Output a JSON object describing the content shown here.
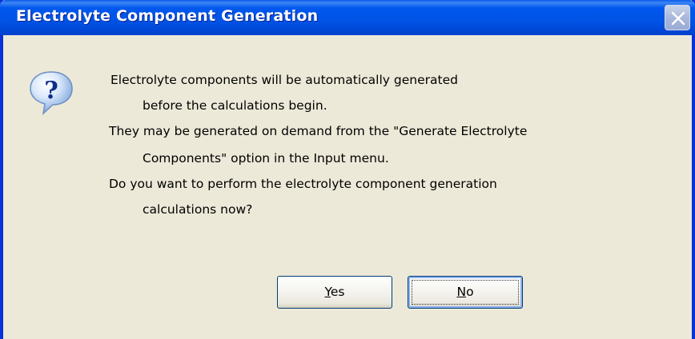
{
  "window": {
    "title": "Electrolyte Component Generation"
  },
  "icons": {
    "close": "close-icon",
    "message": "question-icon"
  },
  "message": {
    "lines": [
      "Electrolyte components will be automatically generated",
      "before the calculations begin.",
      "They may be generated on demand from the \"Generate Electrolyte",
      "Components\" option in the Input menu.",
      "Do you want to perform the electrolyte component generation",
      "calculations now?"
    ]
  },
  "buttons": {
    "yes_mnemonic": "Y",
    "yes_rest": "es",
    "no_mnemonic": "N",
    "no_rest": "o"
  },
  "colors": {
    "titlebar": "#0058ee",
    "frame": "#0831d9",
    "dialog_bg": "#ece9d8"
  }
}
